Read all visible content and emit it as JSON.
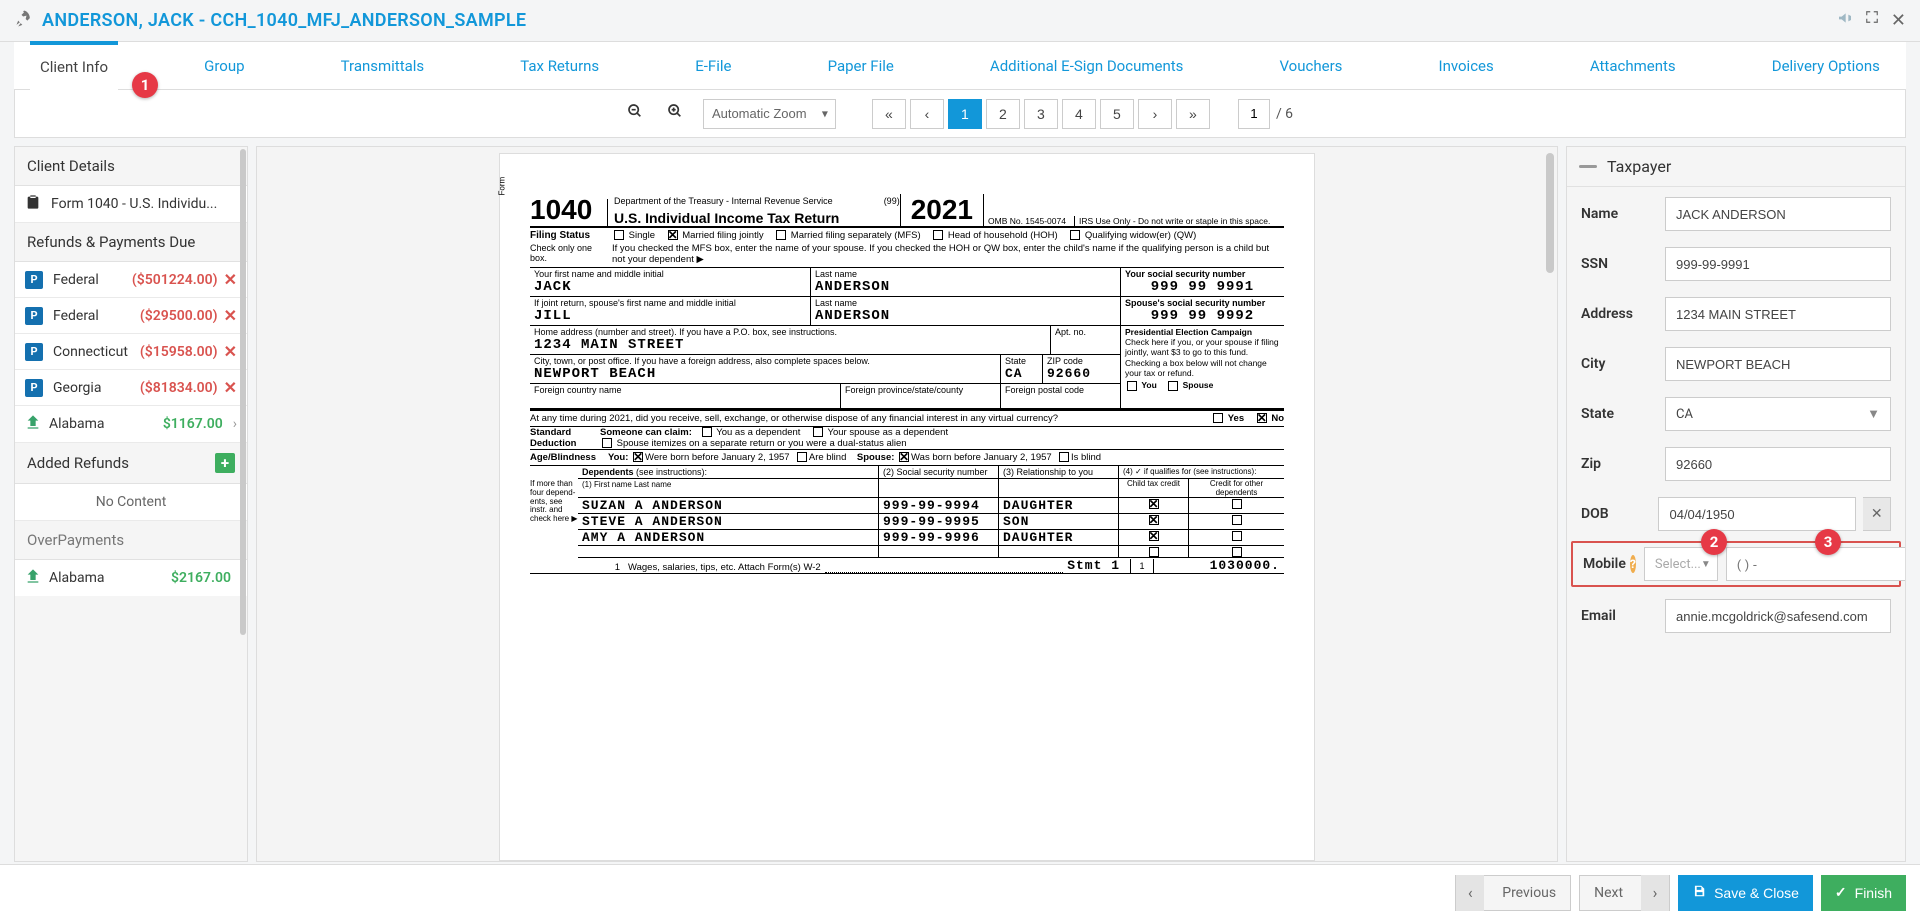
{
  "header": {
    "title": "ANDERSON, JACK - CCH_1040_MFJ_ANDERSON_SAMPLE"
  },
  "tabs": [
    {
      "label": "Client Info",
      "active": true
    },
    {
      "label": "Group"
    },
    {
      "label": "Transmittals"
    },
    {
      "label": "Tax Returns"
    },
    {
      "label": "E-File"
    },
    {
      "label": "Paper File"
    },
    {
      "label": "Additional E-Sign Documents"
    },
    {
      "label": "Vouchers"
    },
    {
      "label": "Invoices"
    },
    {
      "label": "Attachments"
    },
    {
      "label": "Delivery Options"
    }
  ],
  "toolbar": {
    "zoom_label": "Automatic Zoom",
    "pages": [
      "1",
      "2",
      "3",
      "4",
      "5"
    ],
    "active_page": "1",
    "page_input": "1",
    "total_pages": "/ 6"
  },
  "sidebar": {
    "details_header": "Client Details",
    "form_item": "Form 1040 - U.S. Individu...",
    "refunds_header": "Refunds & Payments Due",
    "refund_items": [
      {
        "icon": "P",
        "name": "Federal",
        "amount": "($501224.00)",
        "neg": true,
        "remove": true
      },
      {
        "icon": "P",
        "name": "Federal",
        "amount": "($29500.00)",
        "neg": true,
        "remove": true
      },
      {
        "icon": "P",
        "name": "Connecticut",
        "amount": "($15958.00)",
        "neg": true,
        "remove": true
      },
      {
        "icon": "P",
        "name": "Georgia",
        "amount": "($81834.00)",
        "neg": true,
        "remove": true
      },
      {
        "icon": "hand",
        "name": "Alabama",
        "amount": "$1167.00",
        "neg": false,
        "chev": true
      }
    ],
    "added_header": "Added Refunds",
    "no_content": "No Content",
    "overpay_header": "OverPayments",
    "overpay_items": [
      {
        "icon": "hand",
        "name": "Alabama",
        "amount": "$2167.00",
        "neg": false
      }
    ]
  },
  "form": {
    "form_no": "1040",
    "form_dept": "Department of the Treasury - Internal Revenue Service",
    "form_title": "U.S. Individual Income Tax Return",
    "form_ninetynine": "(99)",
    "year": "2021",
    "omb": "OMB No. 1545-0074",
    "irs_use": "IRS Use Only - Do not write or staple in this space.",
    "filing_status_label": "Filing Status",
    "filing_hint": "Check only one box.",
    "fs_single": "Single",
    "fs_mfj": "Married filing jointly",
    "fs_mfs": "Married filing separately (MFS)",
    "fs_hoh": "Head of household (HOH)",
    "fs_qw": "Qualifying widow(er) (QW)",
    "fs_mfs_note": "If you checked the MFS box, enter the name of your spouse. If you checked the HOH or QW box, enter the child's name if the qualifying person is a child but not your dependent   ▶",
    "first_label": "Your first name and middle initial",
    "last_label": "Last name",
    "ssn_label": "Your social security number",
    "first": "JACK",
    "last": "ANDERSON",
    "ssn": "999  99  9991",
    "sp_first_label": "If joint return, spouse's first name and middle initial",
    "sp_last_label": "Last name",
    "sp_ssn_label": "Spouse's social security number",
    "sp_first": "JILL",
    "sp_last": "ANDERSON",
    "sp_ssn": "999  99  9992",
    "addr_label": "Home address (number and street). If you have a P.O. box, see instructions.",
    "apt_label": "Apt. no.",
    "addr": "1234 MAIN STREET",
    "pec_title": "Presidential Election Campaign",
    "pec_text": "Check here if you, or your spouse if filing jointly, want $3 to go to this fund. Checking a box below will not change your tax or refund.",
    "pec_you": "You",
    "pec_sp": "Spouse",
    "city_label": "City, town, or post office. If you have a foreign address, also complete spaces below.",
    "state_label": "State",
    "zip_label": "ZIP code",
    "city": "NEWPORT BEACH",
    "state": "CA",
    "zip": "92660",
    "fc_label": "Foreign country name",
    "fp_label": "Foreign province/state/county",
    "fz_label": "Foreign postal code",
    "virtual": "At any time during 2021, did you receive, sell, exchange, or otherwise dispose of any financial interest in any virtual currency?",
    "yes": "Yes",
    "no": "No",
    "std_label": "Standard Deduction",
    "someone": "Someone can claim:",
    "you_dep": "You as a dependent",
    "sp_dep": "Your spouse as a dependent",
    "spouse_itemize": "Spouse itemizes on a separate return or you were a dual-status alien",
    "age_label": "Age/Blindness",
    "you_l": "You:",
    "born1": "Were born before January 2, 1957",
    "blind1": "Are blind",
    "sp_l": "Spouse:",
    "born2": "Was born before January 2, 1957",
    "blind2": "Is blind",
    "dep_label": "Dependents",
    "dep_hint": "(see instructions):",
    "dep_more": "If more than four depend-ents, see instr. and check here  ▶",
    "dep_c1": "(1) First name                Last name",
    "dep_c2": "(2) Social security number",
    "dep_c3": "(3) Relationship to you",
    "dep_c4": "(4) ✓  if qualifies for (see instructions):",
    "dep_c4a": "Child tax credit",
    "dep_c4b": "Credit for other dependents",
    "dependents": [
      {
        "name": "SUZAN A ANDERSON",
        "ssn": "999-99-9994",
        "rel": "DAUGHTER"
      },
      {
        "name": "STEVE A ANDERSON",
        "ssn": "999-99-9995",
        "rel": "SON"
      },
      {
        "name": "AMY A ANDERSON",
        "ssn": "999-99-9996",
        "rel": "DAUGHTER"
      }
    ],
    "line1_no": "1",
    "line1": "Wages, salaries, tips, etc. Attach Form(s) W-2",
    "stmt": "Stmt  1",
    "line1_box": "1",
    "line1_amt": "1030000."
  },
  "taxpayer": {
    "header": "Taxpayer",
    "name_l": "Name",
    "name": "JACK ANDERSON",
    "ssn_l": "SSN",
    "ssn": "999-99-9991",
    "addr_l": "Address",
    "addr": "1234 MAIN STREET",
    "city_l": "City",
    "city": "NEWPORT BEACH",
    "state_l": "State",
    "state": "CA",
    "zip_l": "Zip",
    "zip": "92660",
    "dob_l": "DOB",
    "dob": "04/04/1950",
    "mobile_l": "Mobile",
    "cc_placeholder": "Select...",
    "mobile_placeholder": "( ) -",
    "email_l": "Email",
    "email": "annie.mcgoldrick@safesend.com"
  },
  "callouts": {
    "c1": "1",
    "c2": "2",
    "c3": "3"
  },
  "footer": {
    "prev": "Previous",
    "next": "Next",
    "save": "Save & Close",
    "finish": "Finish"
  }
}
